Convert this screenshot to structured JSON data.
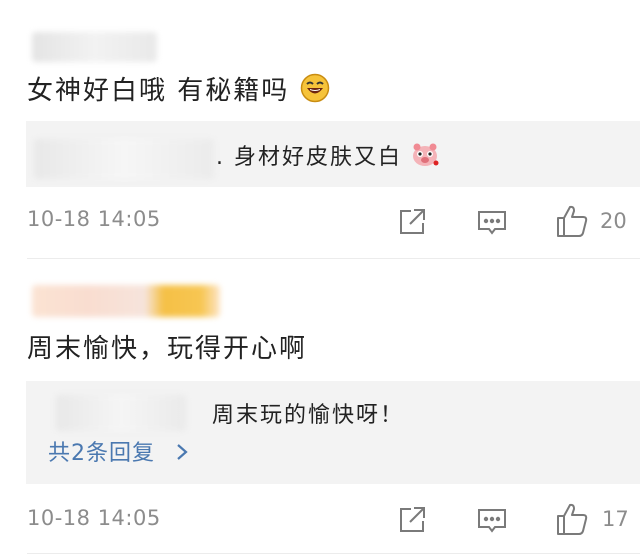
{
  "comments": [
    {
      "text": "女神好白哦  有秘籍吗",
      "emoji": "laughing-face-emoji",
      "reply": {
        "text": ". 身材好皮肤又白",
        "emoji": "pig-face-emoji"
      },
      "timestamp": "10-18 14:05",
      "likes": "20"
    },
    {
      "text": "周末愉快，玩得开心啊",
      "reply": {
        "text": "周末玩的愉快呀！",
        "more_label": "共2条回复"
      },
      "timestamp": "10-18 14:05",
      "likes": "17"
    }
  ],
  "icons": {
    "share": "share-icon",
    "reply": "reply-icon",
    "like": "like-icon",
    "chevron": "chevron-right-icon"
  },
  "colors": {
    "link": "#4a78b0",
    "meta": "#8c8c8c",
    "reply_bg": "#f3f3f3",
    "avatar_blur_accent": "#f5c046"
  }
}
